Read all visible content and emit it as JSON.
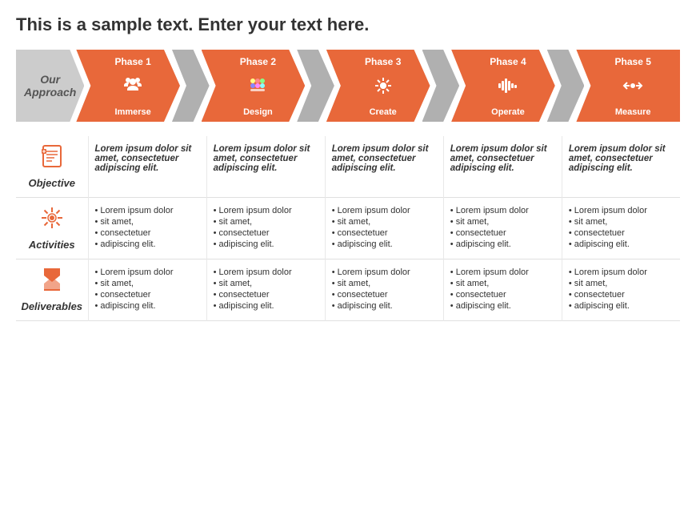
{
  "title": "This is a sample text. Enter your text here.",
  "approach_label": "Our\nApproach",
  "phases": [
    {
      "id": 1,
      "label": "Phase 1",
      "sub": "Immerse",
      "color": "orange",
      "icon": "👥"
    },
    {
      "id": 2,
      "label": "Phase 2",
      "sub": "Design",
      "color": "orange",
      "icon": "🎨"
    },
    {
      "id": 3,
      "label": "Phase 3",
      "sub": "Create",
      "color": "orange",
      "icon": "⚙"
    },
    {
      "id": 4,
      "label": "Phase 4",
      "sub": "Operate",
      "color": "orange",
      "icon": "📶"
    },
    {
      "id": 5,
      "label": "Phase 5",
      "sub": "Measure",
      "color": "orange",
      "icon": "↔"
    }
  ],
  "rows": [
    {
      "id": "objective",
      "label": "Objective",
      "icon_type": "list",
      "italic": true,
      "cells": [
        "Lorem ipsum dolor sit amet, consectetuer adipiscing elit.",
        "Lorem ipsum dolor sit amet, consectetuer adipiscing elit.",
        "Lorem ipsum dolor sit amet, consectetuer adipiscing elit.",
        "Lorem ipsum dolor sit amet, consectetuer adipiscing elit.",
        "Lorem ipsum dolor sit amet, consectetuer adipiscing elit."
      ]
    },
    {
      "id": "activities",
      "label": "Activities",
      "icon_type": "star",
      "italic": false,
      "cells_list": [
        [
          "Lorem ipsum dolor",
          "sit amet,",
          "consectetuer",
          "adipiscing elit."
        ],
        [
          "Lorem ipsum dolor",
          "sit amet,",
          "consectetuer",
          "adipiscing elit."
        ],
        [
          "Lorem ipsum dolor",
          "sit amet,",
          "consectetuer",
          "adipiscing elit."
        ],
        [
          "Lorem ipsum dolor",
          "sit amet,",
          "consectetuer",
          "adipiscing elit."
        ],
        [
          "Lorem ipsum dolor",
          "sit amet,",
          "consectetuer",
          "adipiscing elit."
        ]
      ]
    },
    {
      "id": "deliverables",
      "label": "Deliverables",
      "icon_type": "hourglass",
      "italic": false,
      "cells_list": [
        [
          "Lorem ipsum dolor",
          "sit amet,",
          "consectetuer",
          "adipiscing elit."
        ],
        [
          "Lorem ipsum dolor",
          "sit amet,",
          "consectetuer",
          "adipiscing elit."
        ],
        [
          "Lorem ipsum dolor",
          "sit amet,",
          "consectetuer",
          "adipiscing elit."
        ],
        [
          "Lorem ipsum dolor",
          "sit amet,",
          "consectetuer",
          "adipiscing elit."
        ],
        [
          "Lorem ipsum dolor",
          "sit amet,",
          "consectetuer",
          "adipiscing elit."
        ]
      ]
    }
  ],
  "colors": {
    "orange": "#e8683a",
    "gray": "#b0b0b0",
    "light_gray": "#e8e8e8"
  }
}
